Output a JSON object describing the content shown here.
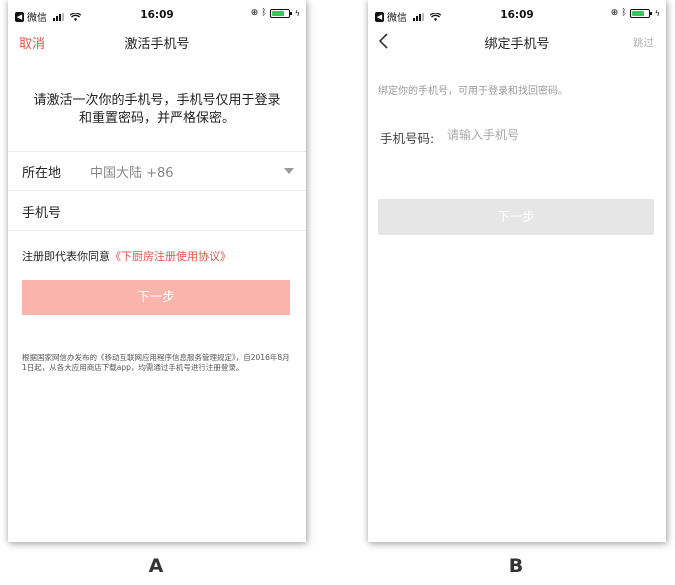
{
  "status_bar": {
    "carrier": "微信",
    "time": "16:09"
  },
  "screen_a": {
    "nav": {
      "left_action": "取消",
      "title": "激活手机号"
    },
    "intro": [
      "请激活一次你的手机号，手机号仅用于登录",
      "和重置密码，并严格保密。"
    ],
    "region_label": "所在地",
    "region_value": "中国大陆 +86",
    "phone_label": "手机号",
    "agree_text": "注册即代表你同意",
    "agree_link": "《下厨房注册使用协议》",
    "next_button": "下一步",
    "notice": "根据国家网信办发布的《移动互联网应用程序信息服务管理规定》，自2016年8月1日起，从各大应用商店下载app，均需通过手机号进行注册登录。"
  },
  "screen_b": {
    "nav": {
      "title": "绑定手机号",
      "right_action": "跳过"
    },
    "hint": "绑定你的手机号，可用于登录和找回密码。",
    "phone_label": "手机号码:",
    "phone_placeholder": "请输入手机号",
    "next_button": "下一步"
  },
  "captions": {
    "a": "A",
    "b": "B"
  },
  "colors": {
    "accent": "#e9534a",
    "button_a": "#fbb4ab",
    "button_b_disabled": "#e6e6e6"
  }
}
